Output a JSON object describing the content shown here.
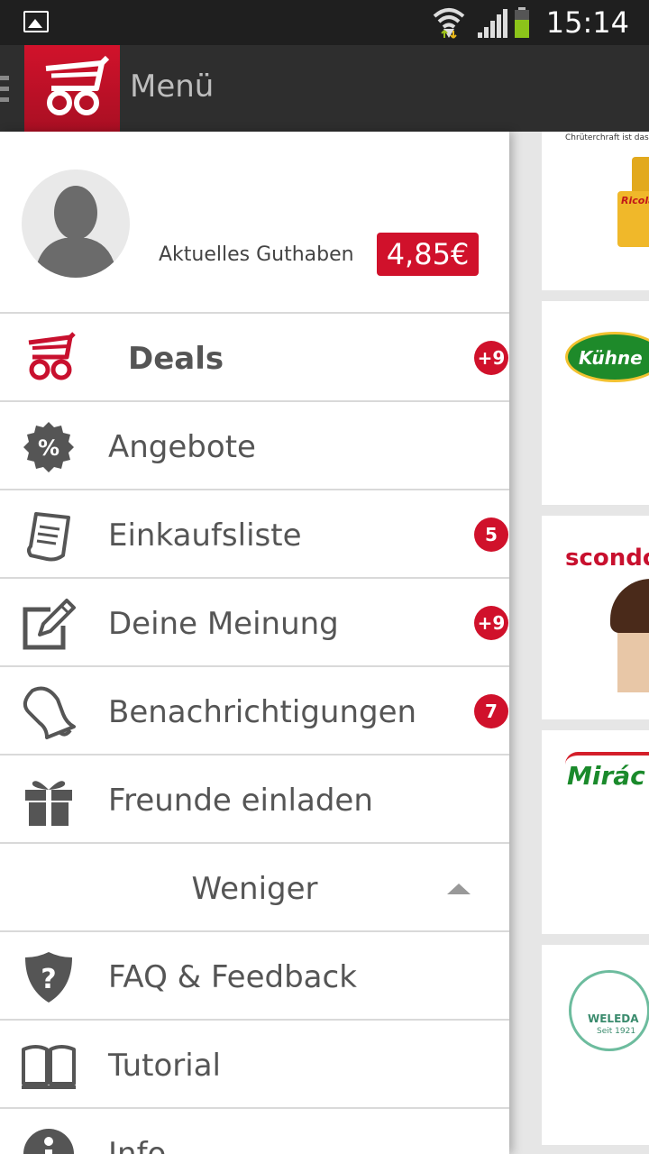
{
  "status_bar": {
    "time": "15:14"
  },
  "action_bar": {
    "title": "Menü"
  },
  "profile": {
    "balance_label": "Aktuelles Guthaben",
    "balance_value": "4,85€"
  },
  "menu": {
    "deals": {
      "label": "Deals",
      "badge": "+9"
    },
    "angebote": {
      "label": "Angebote"
    },
    "einkaufsliste": {
      "label": "Einkaufsliste",
      "badge": "5"
    },
    "meinung": {
      "label": "Deine Meinung",
      "badge": "+9"
    },
    "benachrichtigungen": {
      "label": "Benachrichtigungen",
      "badge": "7"
    },
    "freunde": {
      "label": "Freunde einladen"
    },
    "toggle": {
      "label": "Weniger"
    },
    "faq": {
      "label": "FAQ & Feedback"
    },
    "tutorial": {
      "label": "Tutorial"
    },
    "info": {
      "label": "Info"
    }
  },
  "background": {
    "brands": [
      "Kühne",
      "scondo",
      "Mirác",
      "WELEDA",
      "Seit 1921",
      "Chrüterchraft ist das Geheimn",
      "Ricola"
    ]
  },
  "colors": {
    "accent": "#d0112b",
    "actionbar": "#2e2e2e",
    "statusbar": "#1f1f1f"
  }
}
